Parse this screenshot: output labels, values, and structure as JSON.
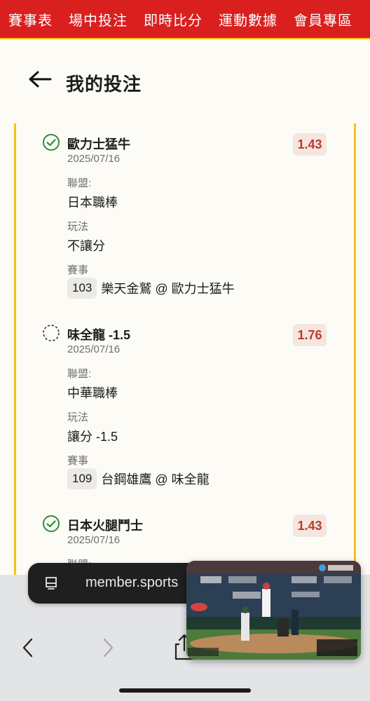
{
  "nav": {
    "items": [
      "賽事表",
      "場中投注",
      "即時比分",
      "運動數據",
      "會員專區"
    ]
  },
  "header": {
    "title": "我的投注"
  },
  "labels": {
    "league": "聯盟:",
    "market": "玩法",
    "event": "賽事"
  },
  "bets": [
    {
      "status": "won",
      "team": "歐力士猛牛",
      "date": "2025/07/16",
      "odds": "1.43",
      "league": "日本職棒",
      "market": "不讓分",
      "event_id": "103",
      "event_name": "樂天金鷲 @ 歐力士猛牛"
    },
    {
      "status": "pending",
      "team": "味全龍 -1.5",
      "date": "2025/07/16",
      "odds": "1.76",
      "league": "中華職棒",
      "market": "讓分 -1.5",
      "event_id": "109",
      "event_name": "台鋼雄鷹 @ 味全龍"
    },
    {
      "status": "won",
      "team": "日本火腿鬥士",
      "date": "2025/07/16",
      "odds": "1.43"
    }
  ],
  "browser": {
    "url": "member.sports"
  },
  "colors": {
    "brand_red": "#d9201f",
    "accent_yellow": "#f2c418",
    "odds_red": "#c0392b"
  },
  "icons": [
    "back-arrow-icon",
    "check-circle-icon",
    "pending-circle-icon",
    "tab-icon",
    "chevron-left-icon",
    "chevron-right-icon",
    "share-icon"
  ]
}
